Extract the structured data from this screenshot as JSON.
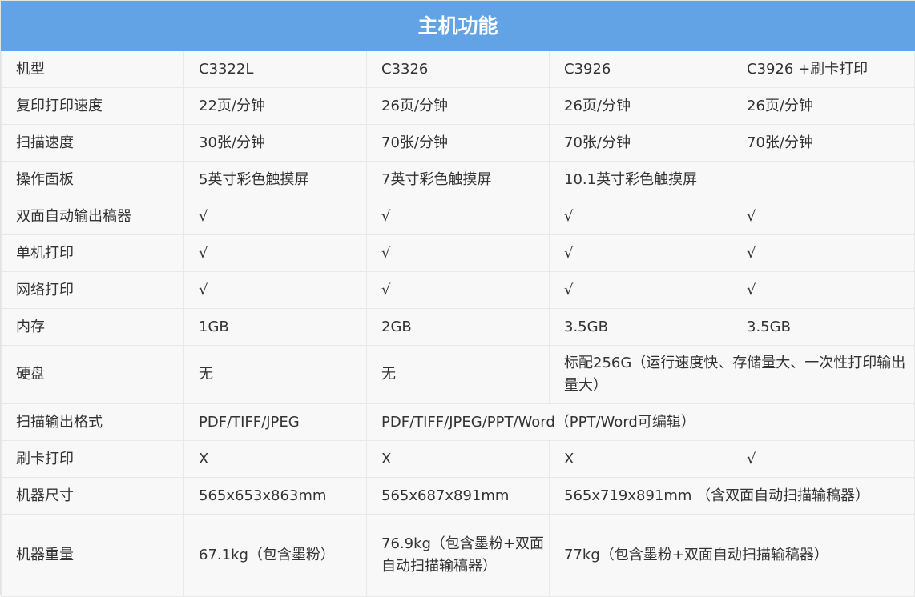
{
  "title": "主机功能",
  "rows": [
    {
      "label": "机型",
      "c1": "C3322L",
      "c2": "C3326",
      "c3": "C3926",
      "c4": "C3926 +刷卡打印"
    },
    {
      "label": "复印打印速度",
      "c1": "22页/分钟",
      "c2": "26页/分钟",
      "c3": "26页/分钟",
      "c4": "26页/分钟"
    },
    {
      "label": "扫描速度",
      "c1": "30张/分钟",
      "c2": "70张/分钟",
      "c3": "70张/分钟",
      "c4": "70张/分钟"
    },
    {
      "label": "操作面板",
      "c1": "5英寸彩色触摸屏",
      "c2": "7英寸彩色触摸屏",
      "c34": "10.1英寸彩色触摸屏"
    },
    {
      "label": "双面自动输出稿器",
      "c1": "√",
      "c2": "√",
      "c3": "√",
      "c4": "√"
    },
    {
      "label": "单机打印",
      "c1": "√",
      "c2": "√",
      "c3": "√",
      "c4": "√"
    },
    {
      "label": "网络打印",
      "c1": "√",
      "c2": "√",
      "c3": "√",
      "c4": "√"
    },
    {
      "label": "内存",
      "c1": "1GB",
      "c2": "2GB",
      "c3": "3.5GB",
      "c4": "3.5GB"
    },
    {
      "label": "硬盘",
      "c1": "无",
      "c2": "无",
      "c34": "标配256G（运行速度快、存储量大、一次性打印输出量大）"
    },
    {
      "label": "扫描输出格式",
      "c1": "PDF/TIFF/JPEG",
      "c234": "PDF/TIFF/JPEG/PPT/Word（PPT/Word可编辑）"
    },
    {
      "label": "刷卡打印",
      "c1": "X",
      "c2": "X",
      "c3": "X",
      "c4": "√"
    },
    {
      "label": "机器尺寸",
      "c1": "565x653x863mm",
      "c2": "565x687x891mm",
      "c34": "565x719x891mm （含双面自动扫描输稿器）"
    },
    {
      "label": "机器重量",
      "c1": "67.1kg（包含墨粉）",
      "c2": "76.9kg（包含墨粉+双面自动扫描输稿器）",
      "c34": "77kg（包含墨粉+双面自动扫描输稿器）"
    }
  ]
}
